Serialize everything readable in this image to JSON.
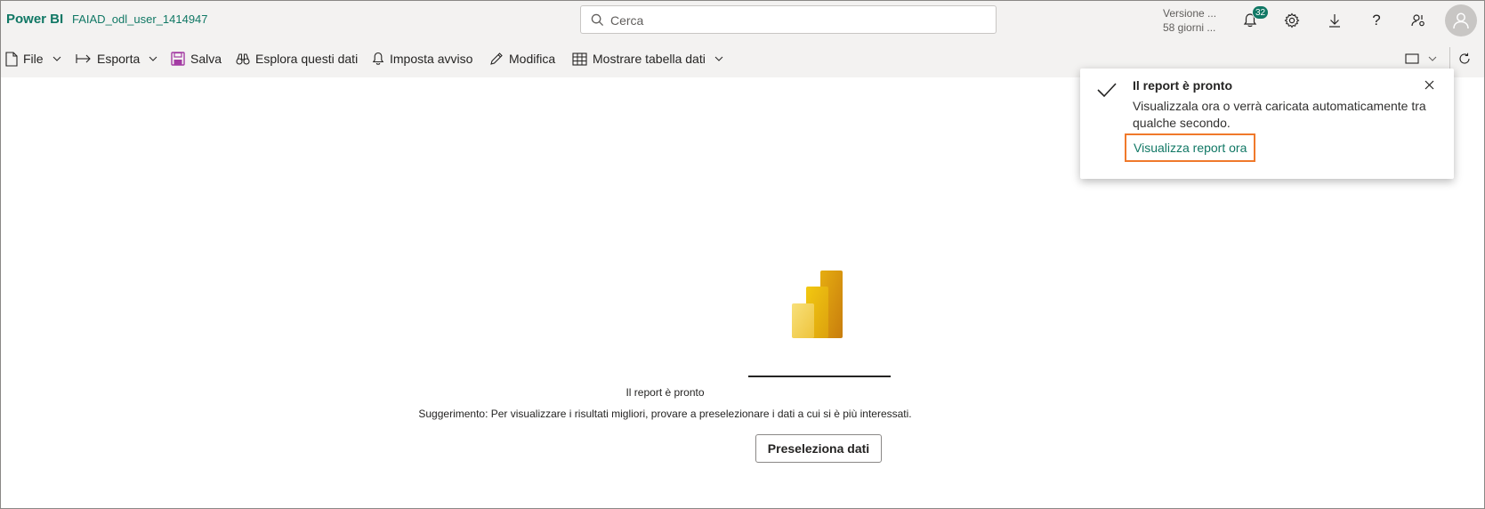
{
  "header": {
    "brand": "Power BI",
    "workspace": "FAIAD_odl_user_1414947",
    "search_placeholder": "Cerca",
    "trial_line1": "Versione ...",
    "trial_line2": "58 giorni ...",
    "notification_count": "32",
    "icons": [
      "bell-icon",
      "gear-icon",
      "download-icon",
      "help-icon",
      "share-icon",
      "avatar-icon"
    ]
  },
  "toolbar": {
    "file": "File",
    "export": "Esporta",
    "save": "Salva",
    "explore": "Esplora questi dati",
    "alert": "Imposta avviso",
    "edit": "Modifica",
    "show_table": "Mostrare tabella dati"
  },
  "toast": {
    "title": "Il report è pronto",
    "message": "Visualizzala ora o verrà caricata automaticamente tra qualche secondo.",
    "link": "Visualizza report ora",
    "highlight_color": "#f0792b"
  },
  "main": {
    "status": "Il report è pronto",
    "tip": "Suggerimento: Per visualizzare i risultati migliori, provare a preselezionare i dati a cui si è più interessati.",
    "button": "Preseleziona dati"
  },
  "colors": {
    "brand": "#117865",
    "logo_gold": "#e8b00e",
    "logo_light": "#f2d054"
  }
}
